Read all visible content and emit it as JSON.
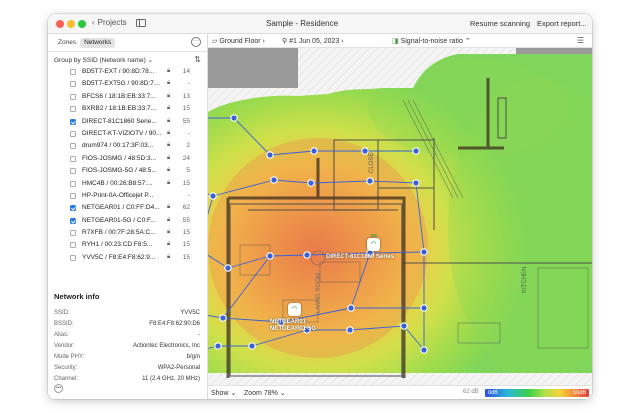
{
  "window": {
    "back_label": "Projects",
    "title": "Sample - Residence",
    "resume_label": "Resume scanning",
    "export_label": "Export report..."
  },
  "sidebar": {
    "tabs": [
      "Zones",
      "Networks"
    ],
    "active_tab": "Networks",
    "group_by": "Group by SSID (Network name)",
    "networks": [
      {
        "name": "BD5T7-EXT / 90:8D:78...",
        "checked": false,
        "locked": true,
        "count": "14"
      },
      {
        "name": "BD5T7-EXT5G / 90:8D:78...",
        "checked": false,
        "locked": true,
        "count": "-"
      },
      {
        "name": "BFCS6 / 18:1B:EB:33:7...",
        "checked": false,
        "locked": true,
        "count": "13"
      },
      {
        "name": "BXRB2 / 18:1B:EB:33:7...",
        "checked": false,
        "locked": true,
        "count": "15"
      },
      {
        "name": "DIRECT-81C1860 Serie...",
        "checked": true,
        "locked": true,
        "count": "55"
      },
      {
        "name": "DIRECT-KT-VIZIOTV / 90...",
        "checked": false,
        "locked": true,
        "count": "-"
      },
      {
        "name": "drum974 / 00:17:3F:03...",
        "checked": false,
        "locked": true,
        "count": "2"
      },
      {
        "name": "FIOS-JOSMG / 48:5D:3...",
        "checked": false,
        "locked": true,
        "count": "24"
      },
      {
        "name": "FIOS-JOSMG-5G / 48:5...",
        "checked": false,
        "locked": true,
        "count": "5"
      },
      {
        "name": "HMC4B / 00:26:B8:57:...",
        "checked": false,
        "locked": true,
        "count": "15"
      },
      {
        "name": "HP-Print-0A-Officejet P...",
        "checked": false,
        "locked": false,
        "count": "-"
      },
      {
        "name": "NETGEAR01 / C0:FF:D4...",
        "checked": true,
        "locked": true,
        "count": "62"
      },
      {
        "name": "NETGEAR01-5G / C0:F...",
        "checked": true,
        "locked": true,
        "count": "55"
      },
      {
        "name": "R7XFB / 00:7F:28:5A:C...",
        "checked": false,
        "locked": true,
        "count": "15"
      },
      {
        "name": "RYH1 / 00:23:CD:F8:5...",
        "checked": false,
        "locked": true,
        "count": "15"
      },
      {
        "name": "YVV5C / F8:E4:F8:62:9...",
        "checked": false,
        "locked": true,
        "count": "15"
      }
    ],
    "info": {
      "title": "Network info",
      "rows": [
        {
          "key": "SSID:",
          "value": "YVV5C"
        },
        {
          "key": "BSSID:",
          "value": "F8:E4:F8:62:90:D6"
        },
        {
          "key": "Alias:",
          "value": "-"
        },
        {
          "key": "Vendor:",
          "value": "Actiontec Electronics, Inc"
        },
        {
          "key": "Mode PHY:",
          "value": "b/g/n"
        },
        {
          "key": "Security:",
          "value": "WPA2-Personal"
        },
        {
          "key": "Channel:",
          "value": "11 (2.4 GHz, 20 MHz)"
        }
      ]
    }
  },
  "toolbar": {
    "floor": "Ground Floor",
    "survey": "#1 Jun 05, 2023",
    "visualization": "Signal-to-noise ratio"
  },
  "map": {
    "room_labels": [
      "CLOSET",
      "LIVING ROOM",
      "KITCHEN"
    ],
    "access_points": [
      {
        "label_line1": "DIRECT-81C1860 Series",
        "label_line2": "",
        "badge": "2G"
      },
      {
        "label_line1": "NETGEAR01",
        "label_line2": "NETGEAR01-5G",
        "badge": ""
      }
    ],
    "route_color": "#3a62d6"
  },
  "bottom": {
    "show_label": "Show",
    "zoom_label": "Zoom 78%",
    "legend_low_tick": "62 dB",
    "legend_left": "0dB",
    "legend_right": "56dB"
  }
}
